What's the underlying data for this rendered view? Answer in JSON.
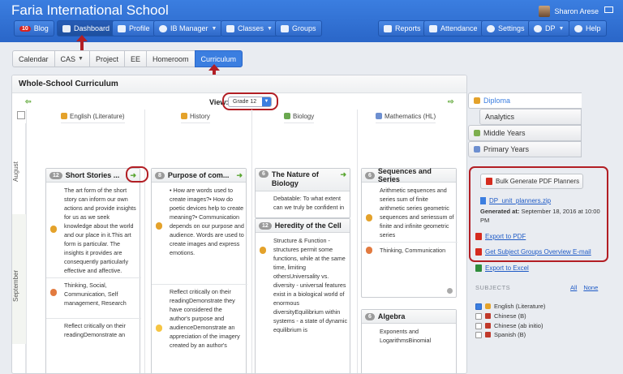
{
  "header": {
    "school": "Faria International School",
    "user_name": "Sharon Arese"
  },
  "nav": {
    "blog_badge": "10",
    "blog": "Blog",
    "dashboard": "Dashboard",
    "profile": "Profile",
    "ib_manager": "IB Manager",
    "classes": "Classes",
    "groups": "Groups",
    "reports": "Reports",
    "attendance": "Attendance",
    "settings": "Settings",
    "qdp": "DP",
    "help": "Help"
  },
  "tabs": [
    "Calendar",
    "CAS",
    "Project",
    "EE",
    "Homeroom",
    "Curriculum"
  ],
  "panel": {
    "title": "Whole-School Curriculum",
    "view_label": "View:",
    "grade": "Grade 12",
    "columns": [
      "English (Literature)",
      "History",
      "Biology",
      "Mathematics (HL)"
    ],
    "months": [
      "August",
      "September"
    ]
  },
  "units": [
    {
      "num": "12",
      "title": "Short Stories ...",
      "text": "The art form of the short story can inform our own actions and provide insights for us as we seek knowledge about the world and our place in it.This art form is particular. The insights it provides are consequently particularly effective and affective.",
      "skills": "Thinking, Social, Communication, Self management, Research",
      "extra": "Reflect critically on their readingDemonstrate an"
    },
    {
      "num": "8",
      "title": "Purpose of com...",
      "text": "• How are words used to create images?• How do poetic devices help to create meaning?• Communication depends on our purpose and audience. Words are used to create images and express emotions.",
      "extra": "Reflect critically on their readingDemonstrate they have considered the author's purpose and audienceDemonstrate an appreciation of the imagery created by an author's"
    },
    {
      "num": "6",
      "title": "The Nature of Biology",
      "text": "Debatable: To what extent can we truly be confident in"
    },
    {
      "num": "12",
      "title": "Heredity of the Cell",
      "text": "Structure & Function - structures permit some functions, while at the same time, limiting othersUniversality vs. diversity - universal features exist in a biological world of enormous diversityEquilibrium within systems - a state of dynamic equilibrium is"
    },
    {
      "num": "6",
      "title": "Sequences and Series",
      "text": "Arithmetic sequences and series sum of finite arithmetic series geometric sequences and seriessum of finite and infinite geometric series",
      "skills": "Thinking, Communication"
    },
    {
      "num": "6",
      "title": "Algebra",
      "text": "Exponents and LogarithmsBinomial"
    }
  ],
  "right": {
    "tabs": [
      "Diploma",
      "Analytics",
      "Middle Years",
      "Primary Years"
    ],
    "bulk_button": "Bulk Generate PDF Planners",
    "zip_file": "DP_unit_planners.zip",
    "generated_label": "Generated at:",
    "generated_value": "September 18, 2016 at 10:00 PM",
    "export_pdf": "Export to PDF",
    "subject_email": "Get Subject Groups Overview E-mail",
    "export_excel": "Export to Excel",
    "subjects_label": "SUBJECTS",
    "all": "All",
    "none": "None",
    "subjects": [
      "English (Literature)",
      "Chinese (B)",
      "Chinese (ab initio)",
      "Spanish (B)"
    ]
  },
  "colors": {
    "brand": "#2d6fd6",
    "highlight": "#b21e24",
    "arrow": "#5aa631"
  }
}
